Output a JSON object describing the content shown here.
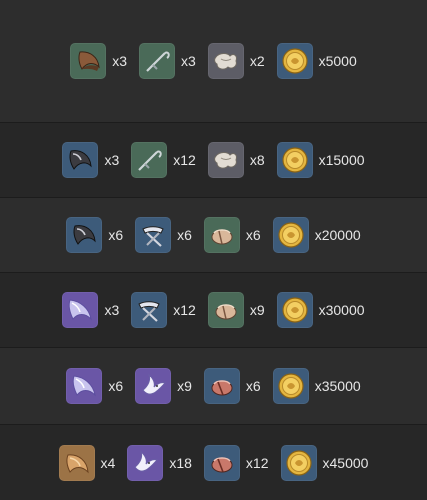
{
  "rarity_colors": {
    "green": "#4a6a58",
    "blue": "#3d5b7a",
    "purple": "#6a56a6",
    "gold": "#9c7346",
    "gray": "#5d5d66"
  },
  "rows": [
    {
      "items": [
        {
          "icon": "brown-fang-icon",
          "rarity": "green",
          "qty": "x3"
        },
        {
          "icon": "hook-chain-icon",
          "rarity": "green",
          "qty": "x3"
        },
        {
          "icon": "cloth-scrap-icon",
          "rarity": "gray",
          "qty": "x2"
        },
        {
          "icon": "mora-coin-icon",
          "rarity": "blue",
          "qty": "x5000"
        }
      ]
    },
    {
      "items": [
        {
          "icon": "dark-fang-icon",
          "rarity": "blue",
          "qty": "x3"
        },
        {
          "icon": "hook-chain-icon",
          "rarity": "green",
          "qty": "x12"
        },
        {
          "icon": "cloth-scrap-icon",
          "rarity": "gray",
          "qty": "x8"
        },
        {
          "icon": "mora-coin-icon",
          "rarity": "blue",
          "qty": "x15000"
        }
      ]
    },
    {
      "items": [
        {
          "icon": "dark-fang-icon",
          "rarity": "blue",
          "qty": "x6"
        },
        {
          "icon": "crossed-blades-icon",
          "rarity": "blue",
          "qty": "x6"
        },
        {
          "icon": "leather-bundle-icon",
          "rarity": "green",
          "qty": "x6"
        },
        {
          "icon": "mora-coin-icon",
          "rarity": "blue",
          "qty": "x20000"
        }
      ]
    },
    {
      "items": [
        {
          "icon": "spirit-fang-icon",
          "rarity": "purple",
          "qty": "x3"
        },
        {
          "icon": "crossed-blades-icon",
          "rarity": "blue",
          "qty": "x12"
        },
        {
          "icon": "leather-bundle-icon",
          "rarity": "green",
          "qty": "x9"
        },
        {
          "icon": "mora-coin-icon",
          "rarity": "blue",
          "qty": "x30000"
        }
      ]
    },
    {
      "items": [
        {
          "icon": "spirit-fang-icon",
          "rarity": "purple",
          "qty": "x6"
        },
        {
          "icon": "white-bird-icon",
          "rarity": "purple",
          "qty": "x9"
        },
        {
          "icon": "red-bundle-icon",
          "rarity": "blue",
          "qty": "x6"
        },
        {
          "icon": "mora-coin-icon",
          "rarity": "blue",
          "qty": "x35000"
        }
      ]
    },
    {
      "items": [
        {
          "icon": "golden-fang-icon",
          "rarity": "gold",
          "qty": "x4"
        },
        {
          "icon": "white-bird-icon",
          "rarity": "purple",
          "qty": "x18"
        },
        {
          "icon": "red-bundle-icon",
          "rarity": "blue",
          "qty": "x12"
        },
        {
          "icon": "mora-coin-icon",
          "rarity": "blue",
          "qty": "x45000"
        }
      ]
    }
  ]
}
